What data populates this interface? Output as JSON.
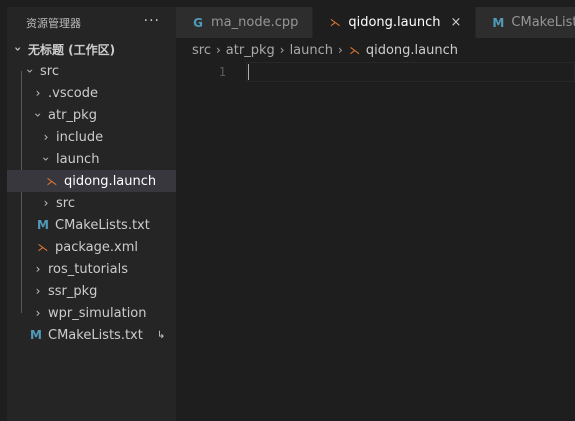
{
  "explorer": {
    "title": "资源管理器",
    "more_label": "···"
  },
  "tree": {
    "workspace": "无标题 (工作区)",
    "items": [
      {
        "label": "src"
      },
      {
        "label": ".vscode"
      },
      {
        "label": "atr_pkg"
      },
      {
        "label": "include"
      },
      {
        "label": "launch"
      },
      {
        "label": "qidong.launch"
      },
      {
        "label": "src"
      },
      {
        "label": "CMakeLists.txt"
      },
      {
        "label": "package.xml"
      },
      {
        "label": "ros_tutorials"
      },
      {
        "label": "ssr_pkg"
      },
      {
        "label": "wpr_simulation"
      },
      {
        "label": "CMakeLists.txt"
      }
    ],
    "link_badge": "↳"
  },
  "tabs": [
    {
      "label": "ma_node.cpp",
      "icon": "C"
    },
    {
      "label": "qidong.launch",
      "icon": "rss"
    },
    {
      "label": "CMakeLists.txt",
      "icon": "M"
    }
  ],
  "tab_close": "×",
  "breadcrumb": [
    "src",
    "atr_pkg",
    "launch",
    "qidong.launch"
  ],
  "breadcrumb_sep": "›",
  "editor": {
    "line_number": "1"
  },
  "icons": {
    "chevron": "›",
    "rss": "⋋",
    "m": "M"
  },
  "colors": {
    "rss": "#e37933",
    "m": "#519aba",
    "selected": "#37373d"
  }
}
